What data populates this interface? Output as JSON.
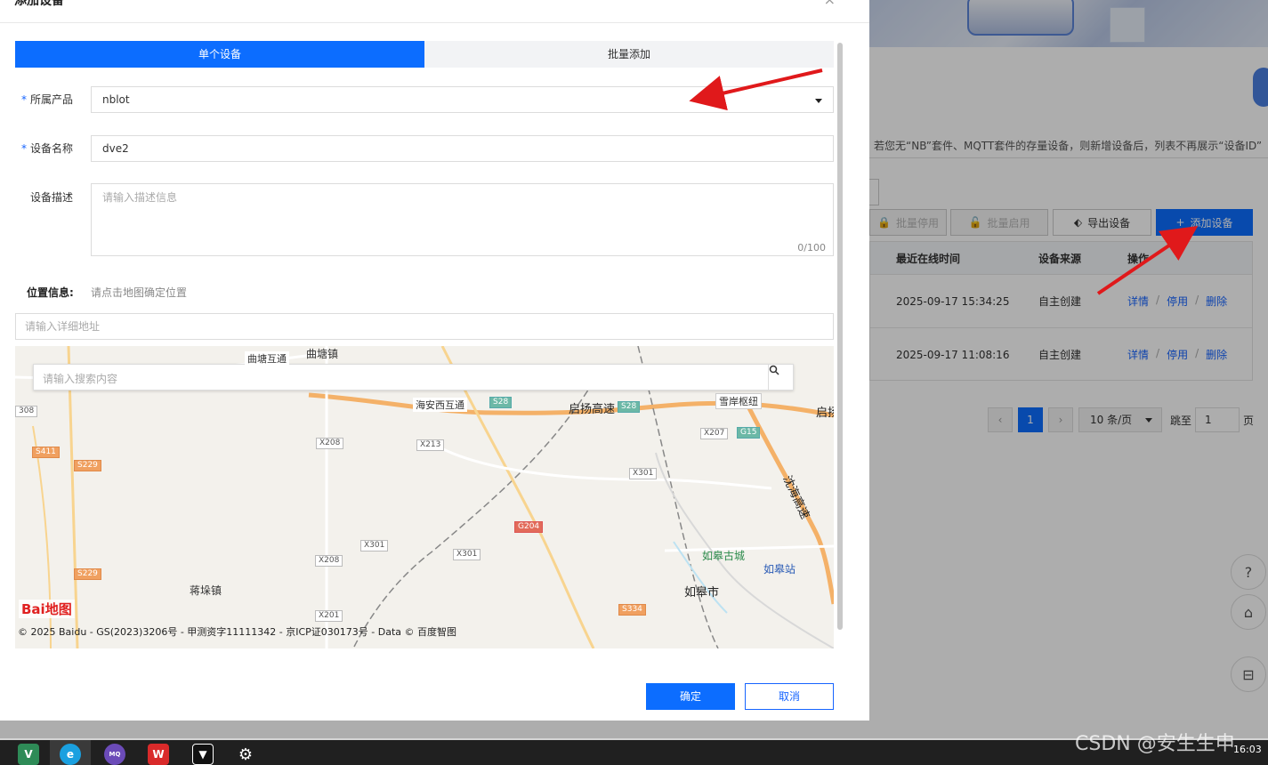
{
  "background": {
    "notice": "若您无“NB”套件、MQTT套件的存量设备，则新增设备后，列表不再展示“设备ID”",
    "buttons": {
      "batch_disable": "批量停用",
      "batch_enable": "批量启用",
      "export": "导出设备",
      "add": "添加设备"
    },
    "table": {
      "headers": [
        "最近在线时间",
        "设备来源",
        "操作"
      ],
      "rows": [
        {
          "time": "2025-09-17 15:34:25",
          "source": "自主创建",
          "ops": [
            "详情",
            "停用",
            "删除"
          ]
        },
        {
          "time": "2025-09-17 11:08:16",
          "source": "自主创建",
          "ops": [
            "详情",
            "停用",
            "删除"
          ]
        }
      ]
    },
    "pager": {
      "prev": "‹",
      "current": "1",
      "next": "›",
      "page_size": "10 条/页",
      "jump_label": "跳至",
      "jump_value": "1",
      "page_unit": "页"
    }
  },
  "dialog": {
    "title": "添加设备",
    "close": "×",
    "tabs": [
      {
        "label": "单个设备",
        "active": true
      },
      {
        "label": "批量添加",
        "active": false
      }
    ],
    "product": {
      "label": "所属产品",
      "value": "nblot",
      "required": true
    },
    "name": {
      "label": "设备名称",
      "value": "dve2",
      "required": true
    },
    "desc": {
      "label": "设备描述",
      "placeholder": "请输入描述信息",
      "counter": "0/100"
    },
    "position": {
      "label": "位置信息:",
      "hint": "请点击地图确定位置"
    },
    "address": {
      "placeholder": "请输入详细地址"
    },
    "map": {
      "search_placeholder": "请输入搜索内容",
      "labels": [
        "曲塘互通",
        "曲塘镇",
        "海安西互通",
        "启扬高速",
        "雪岸枢纽",
        "沈海高速",
        "如皋古城",
        "如皋站",
        "如皋市",
        "蒋垛镇",
        "启扬"
      ],
      "road_tags": [
        "S28",
        "S28",
        "G15",
        "X207",
        "X208",
        "X213",
        "X301",
        "X301",
        "X301",
        "X208",
        "X201",
        "G204",
        "S334",
        "S411",
        "S229",
        "S229",
        "308"
      ],
      "logo": "Bai地图",
      "copyright": "© 2025 Baidu - GS(2023)3206号 - 甲测资字11111342 - 京ICP证030173号 - Data © 百度智图"
    },
    "ok": "确定",
    "cancel": "取消"
  },
  "taskbar": {
    "watermark": "CSDN @安生生申",
    "clock": "16:03"
  },
  "colors": {
    "primary": "#0c6dff",
    "link": "#1664ff",
    "arrow": "#e0191b"
  }
}
